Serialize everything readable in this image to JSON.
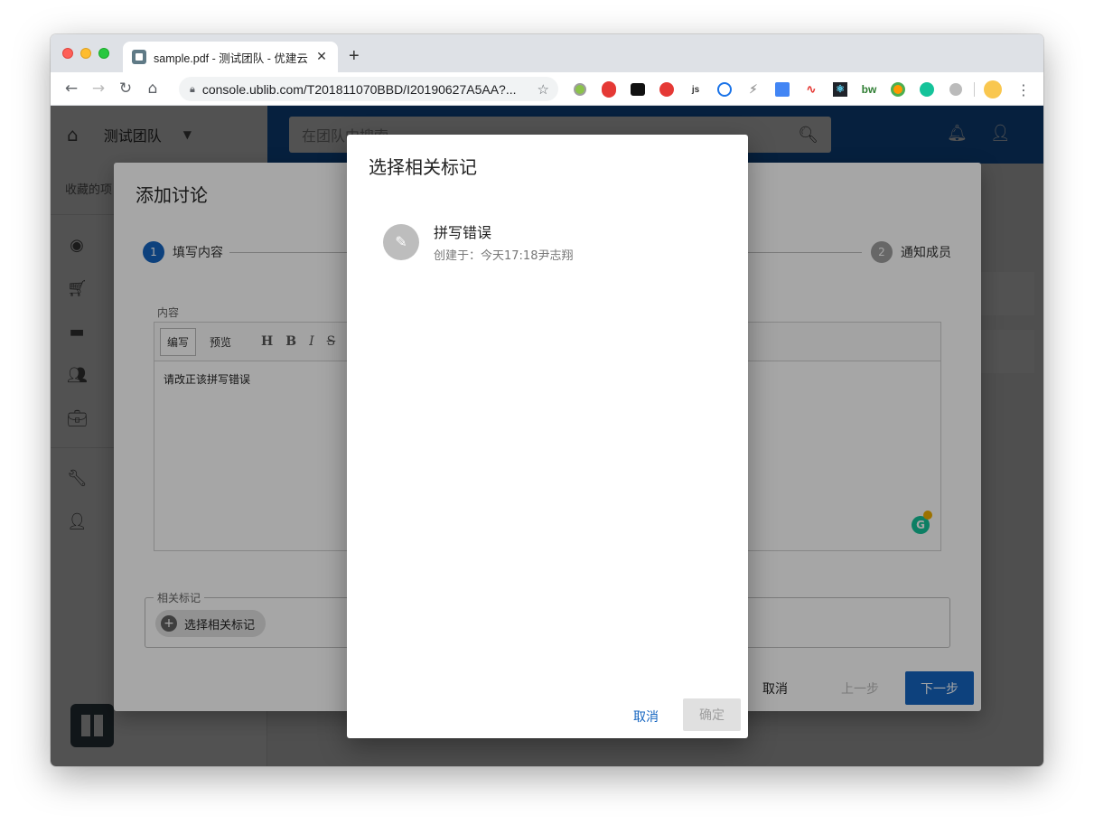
{
  "browser": {
    "tab_title": "sample.pdf - 测试团队 - 优建云",
    "tab_close": "✕",
    "new_tab": "+",
    "url": "console.ublib.com/T201811070BBD/I20190627A5AA?...",
    "extensions": [
      "green-circle",
      "red-hand",
      "black-glasses",
      "red-trash",
      "js",
      "1password",
      "bolt",
      "google-translate",
      "chart-line",
      "react",
      "bw",
      "color-circle",
      "grammarly",
      "gray-flower"
    ]
  },
  "app": {
    "team_name": "测试团队",
    "search_placeholder": "在团队中搜索",
    "favorites_label": "收藏的项目"
  },
  "dialog_add": {
    "title": "添加讨论",
    "step1_num": "1",
    "step1_label": "填写内容",
    "step2_num": "2",
    "step2_label": "通知成员",
    "content_label": "内容",
    "editor_tab_write": "编写",
    "editor_tab_preview": "预览",
    "editor_buttons": [
      "H",
      "B",
      "I",
      "S"
    ],
    "content_text": "请改正该拼写错误",
    "tags_label": "相关标记",
    "select_tags_button": "选择相关标记",
    "cancel": "取消",
    "prev": "上一步",
    "next": "下一步"
  },
  "dialog_select": {
    "title": "选择相关标记",
    "items": [
      {
        "name": "拼写错误",
        "meta": "创建于：今天17:18尹志翔"
      }
    ],
    "cancel": "取消",
    "confirm": "确定"
  },
  "colors": {
    "primary": "#1565c0",
    "overlay": "#000000"
  }
}
